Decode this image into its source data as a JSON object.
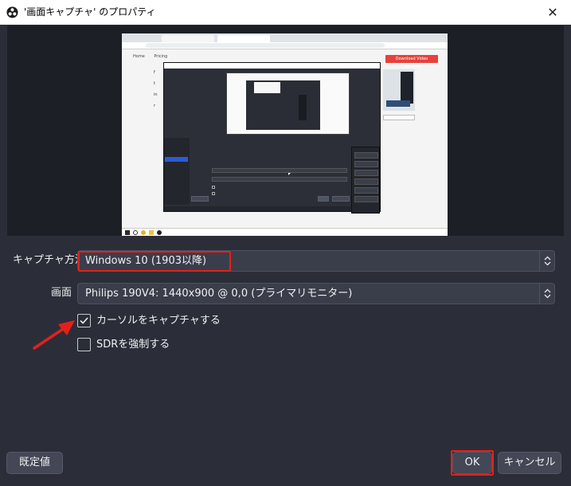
{
  "window": {
    "title": "'画面キャプチャ' のプロパティ",
    "close_glyph": "✕"
  },
  "preview": {
    "browser_button": "Download Video Converter",
    "nav_home": "Home",
    "nav_pricing": "Pricing"
  },
  "form": {
    "capture_method": {
      "label": "キャプチャ方法",
      "value": "Windows 10 (1903以降)"
    },
    "display": {
      "label": "画面",
      "value": "Philips 190V4: 1440x900 @ 0,0 (プライマリモニター)"
    },
    "capture_cursor": {
      "label": "カーソルをキャプチャする",
      "checked": true
    },
    "force_sdr": {
      "label": "SDRを強制する",
      "checked": false
    }
  },
  "buttons": {
    "defaults": "既定値",
    "ok": "OK",
    "cancel": "キャンセル"
  },
  "colors": {
    "background": "#2b2e38",
    "highlight": "#e5201a",
    "control": "#3a3e4b"
  },
  "icons": {
    "app": "obs-logo-icon",
    "combo": "updown-chevron-icon",
    "check": "checkmark-icon",
    "annotation": "red-arrow-icon"
  }
}
